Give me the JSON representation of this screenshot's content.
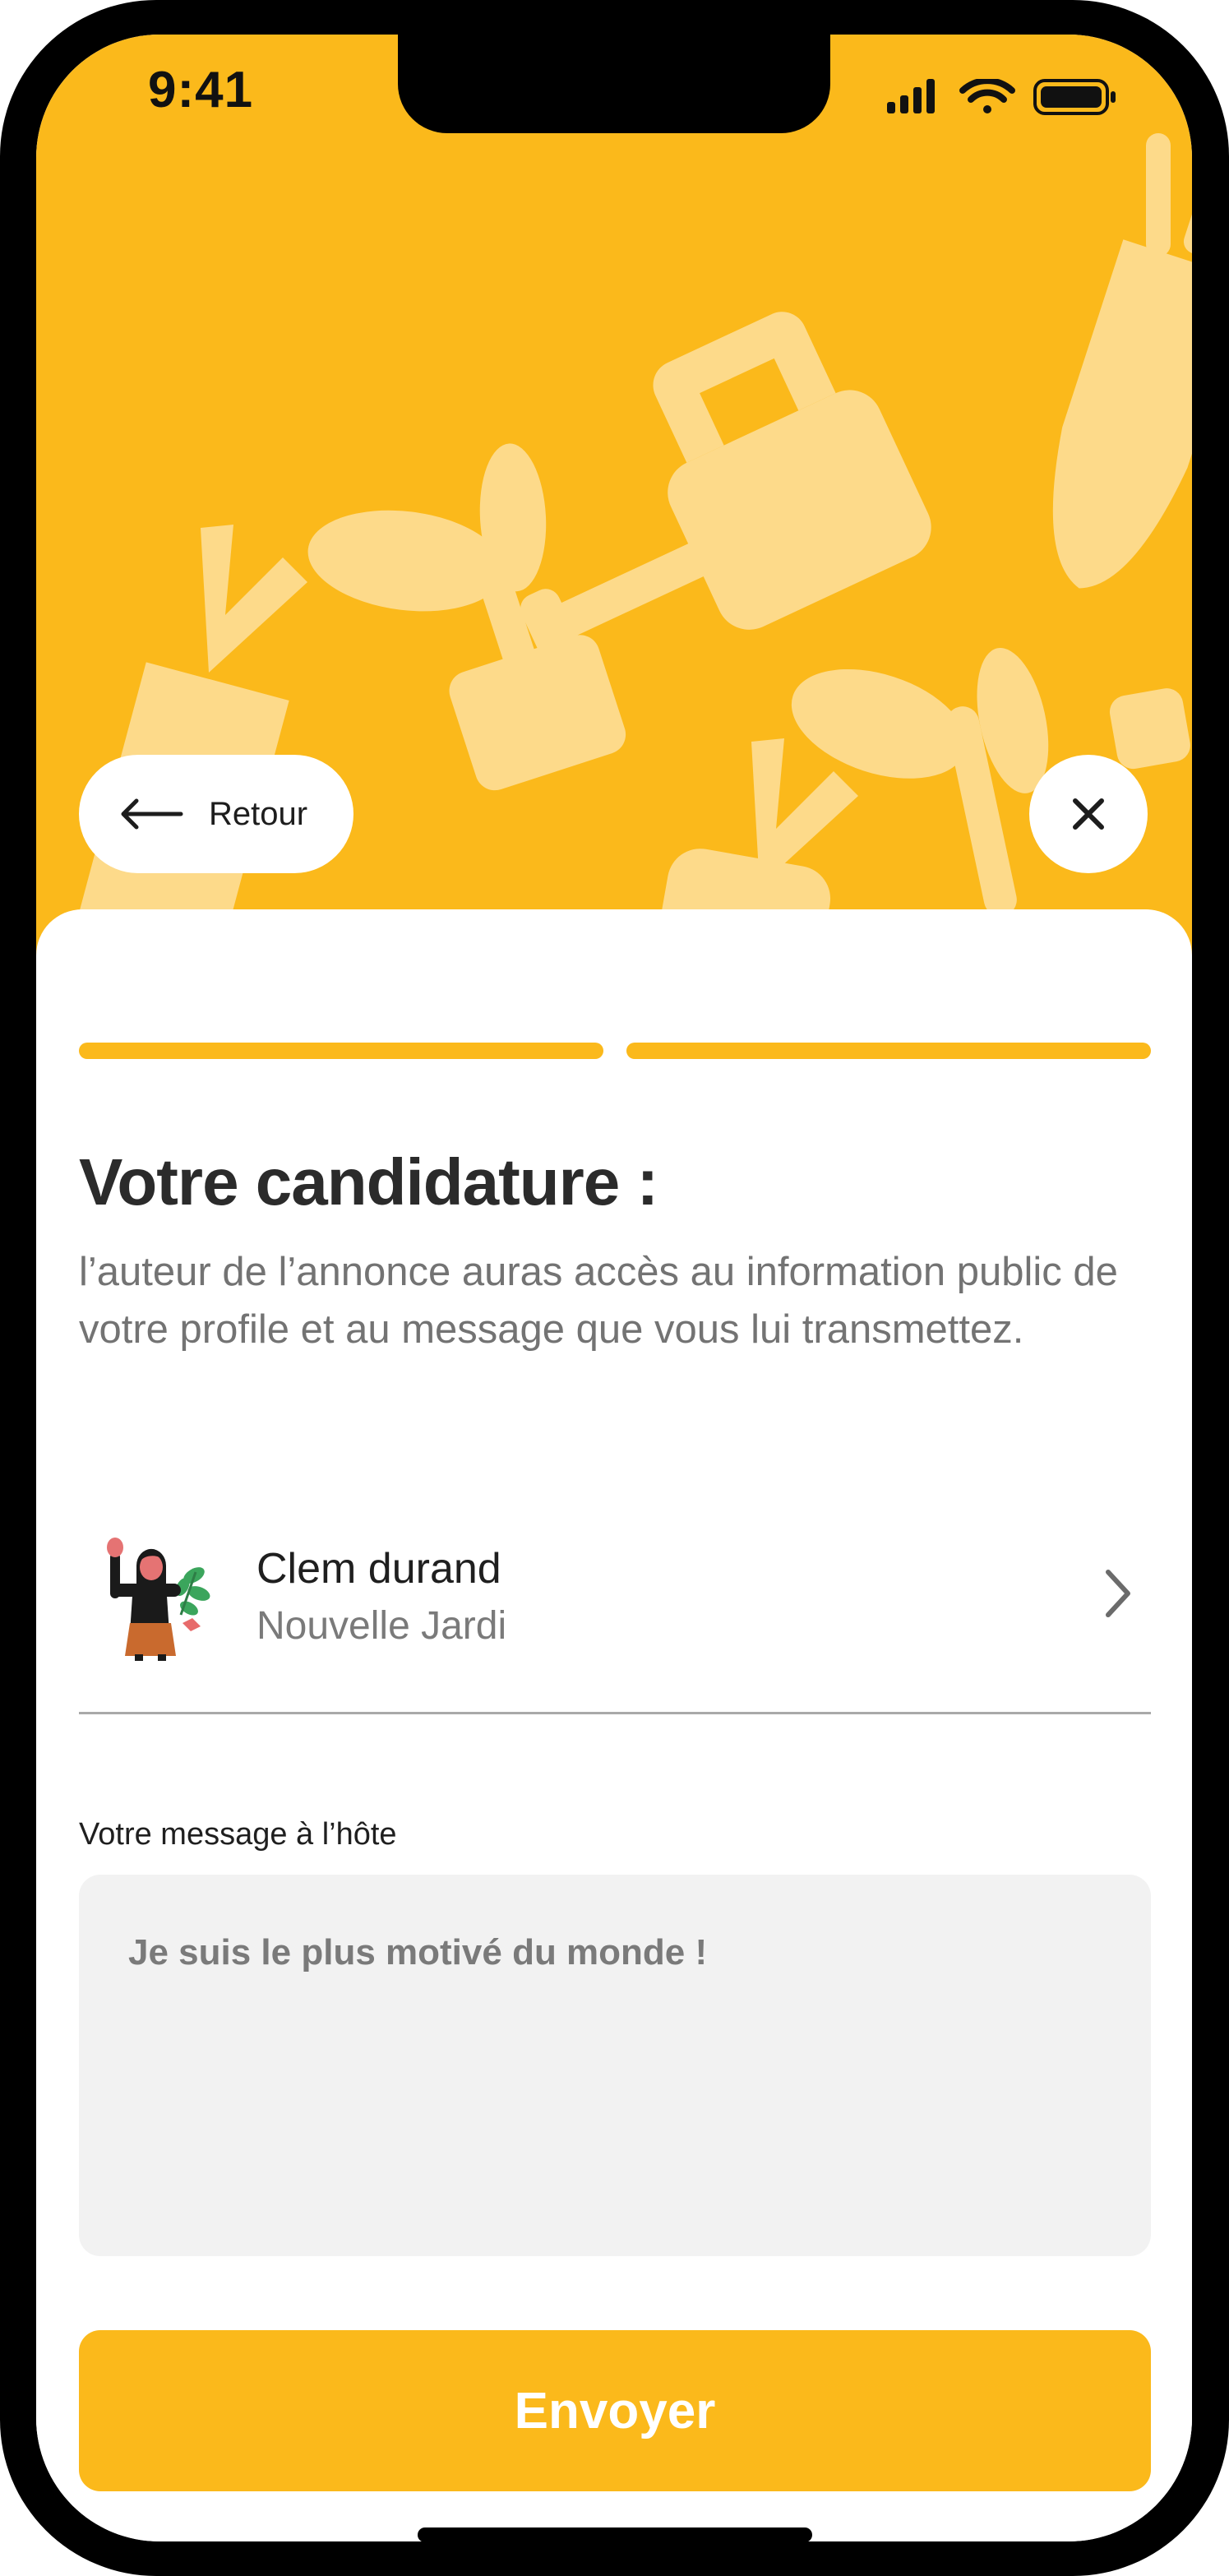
{
  "status_bar": {
    "time": "9:41"
  },
  "nav": {
    "back_label": "Retour"
  },
  "progress": {
    "current_step": 2,
    "total_steps": 2
  },
  "heading": {
    "title": "Votre candidature :",
    "subtitle": "l’auteur de l’annonce auras accès au information public de votre profile et au message que vous lui transmettez."
  },
  "profile": {
    "name": "Clem durand",
    "role": "Nouvelle Jardi"
  },
  "message": {
    "label": "Votre message à l’hôte",
    "value": "Je suis le plus motivé du monde !"
  },
  "submit": {
    "label": "Envoyer"
  },
  "colors": {
    "accent": "#FBB91B",
    "pattern": "#FDDA8A",
    "text_muted": "#737373"
  },
  "icons": [
    "signal-icon",
    "wifi-icon",
    "battery-icon",
    "arrow-left-icon",
    "close-icon",
    "chevron-right-icon"
  ]
}
